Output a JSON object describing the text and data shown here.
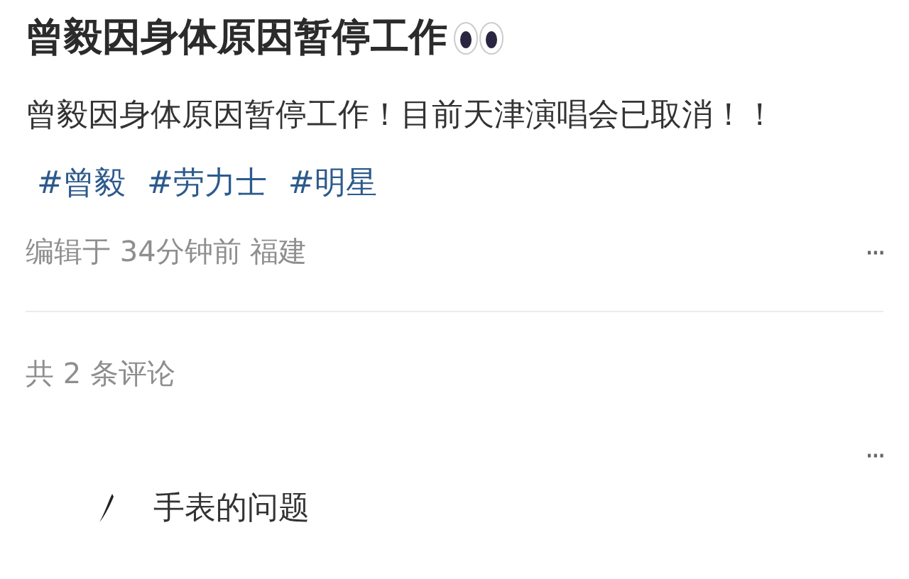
{
  "post": {
    "title": "曾毅因身体原因暂停工作",
    "body": "曾毅因身体原因暂停工作！目前天津演唱会已取消！！",
    "tags": [
      "#曾毅",
      "#劳力士",
      "#明星"
    ],
    "meta": "编辑于 34分钟前 福建",
    "more": "···"
  },
  "comments": {
    "count_label": "共 2 条评论",
    "more": "···",
    "items": [
      {
        "text": "手表的问题"
      }
    ]
  }
}
